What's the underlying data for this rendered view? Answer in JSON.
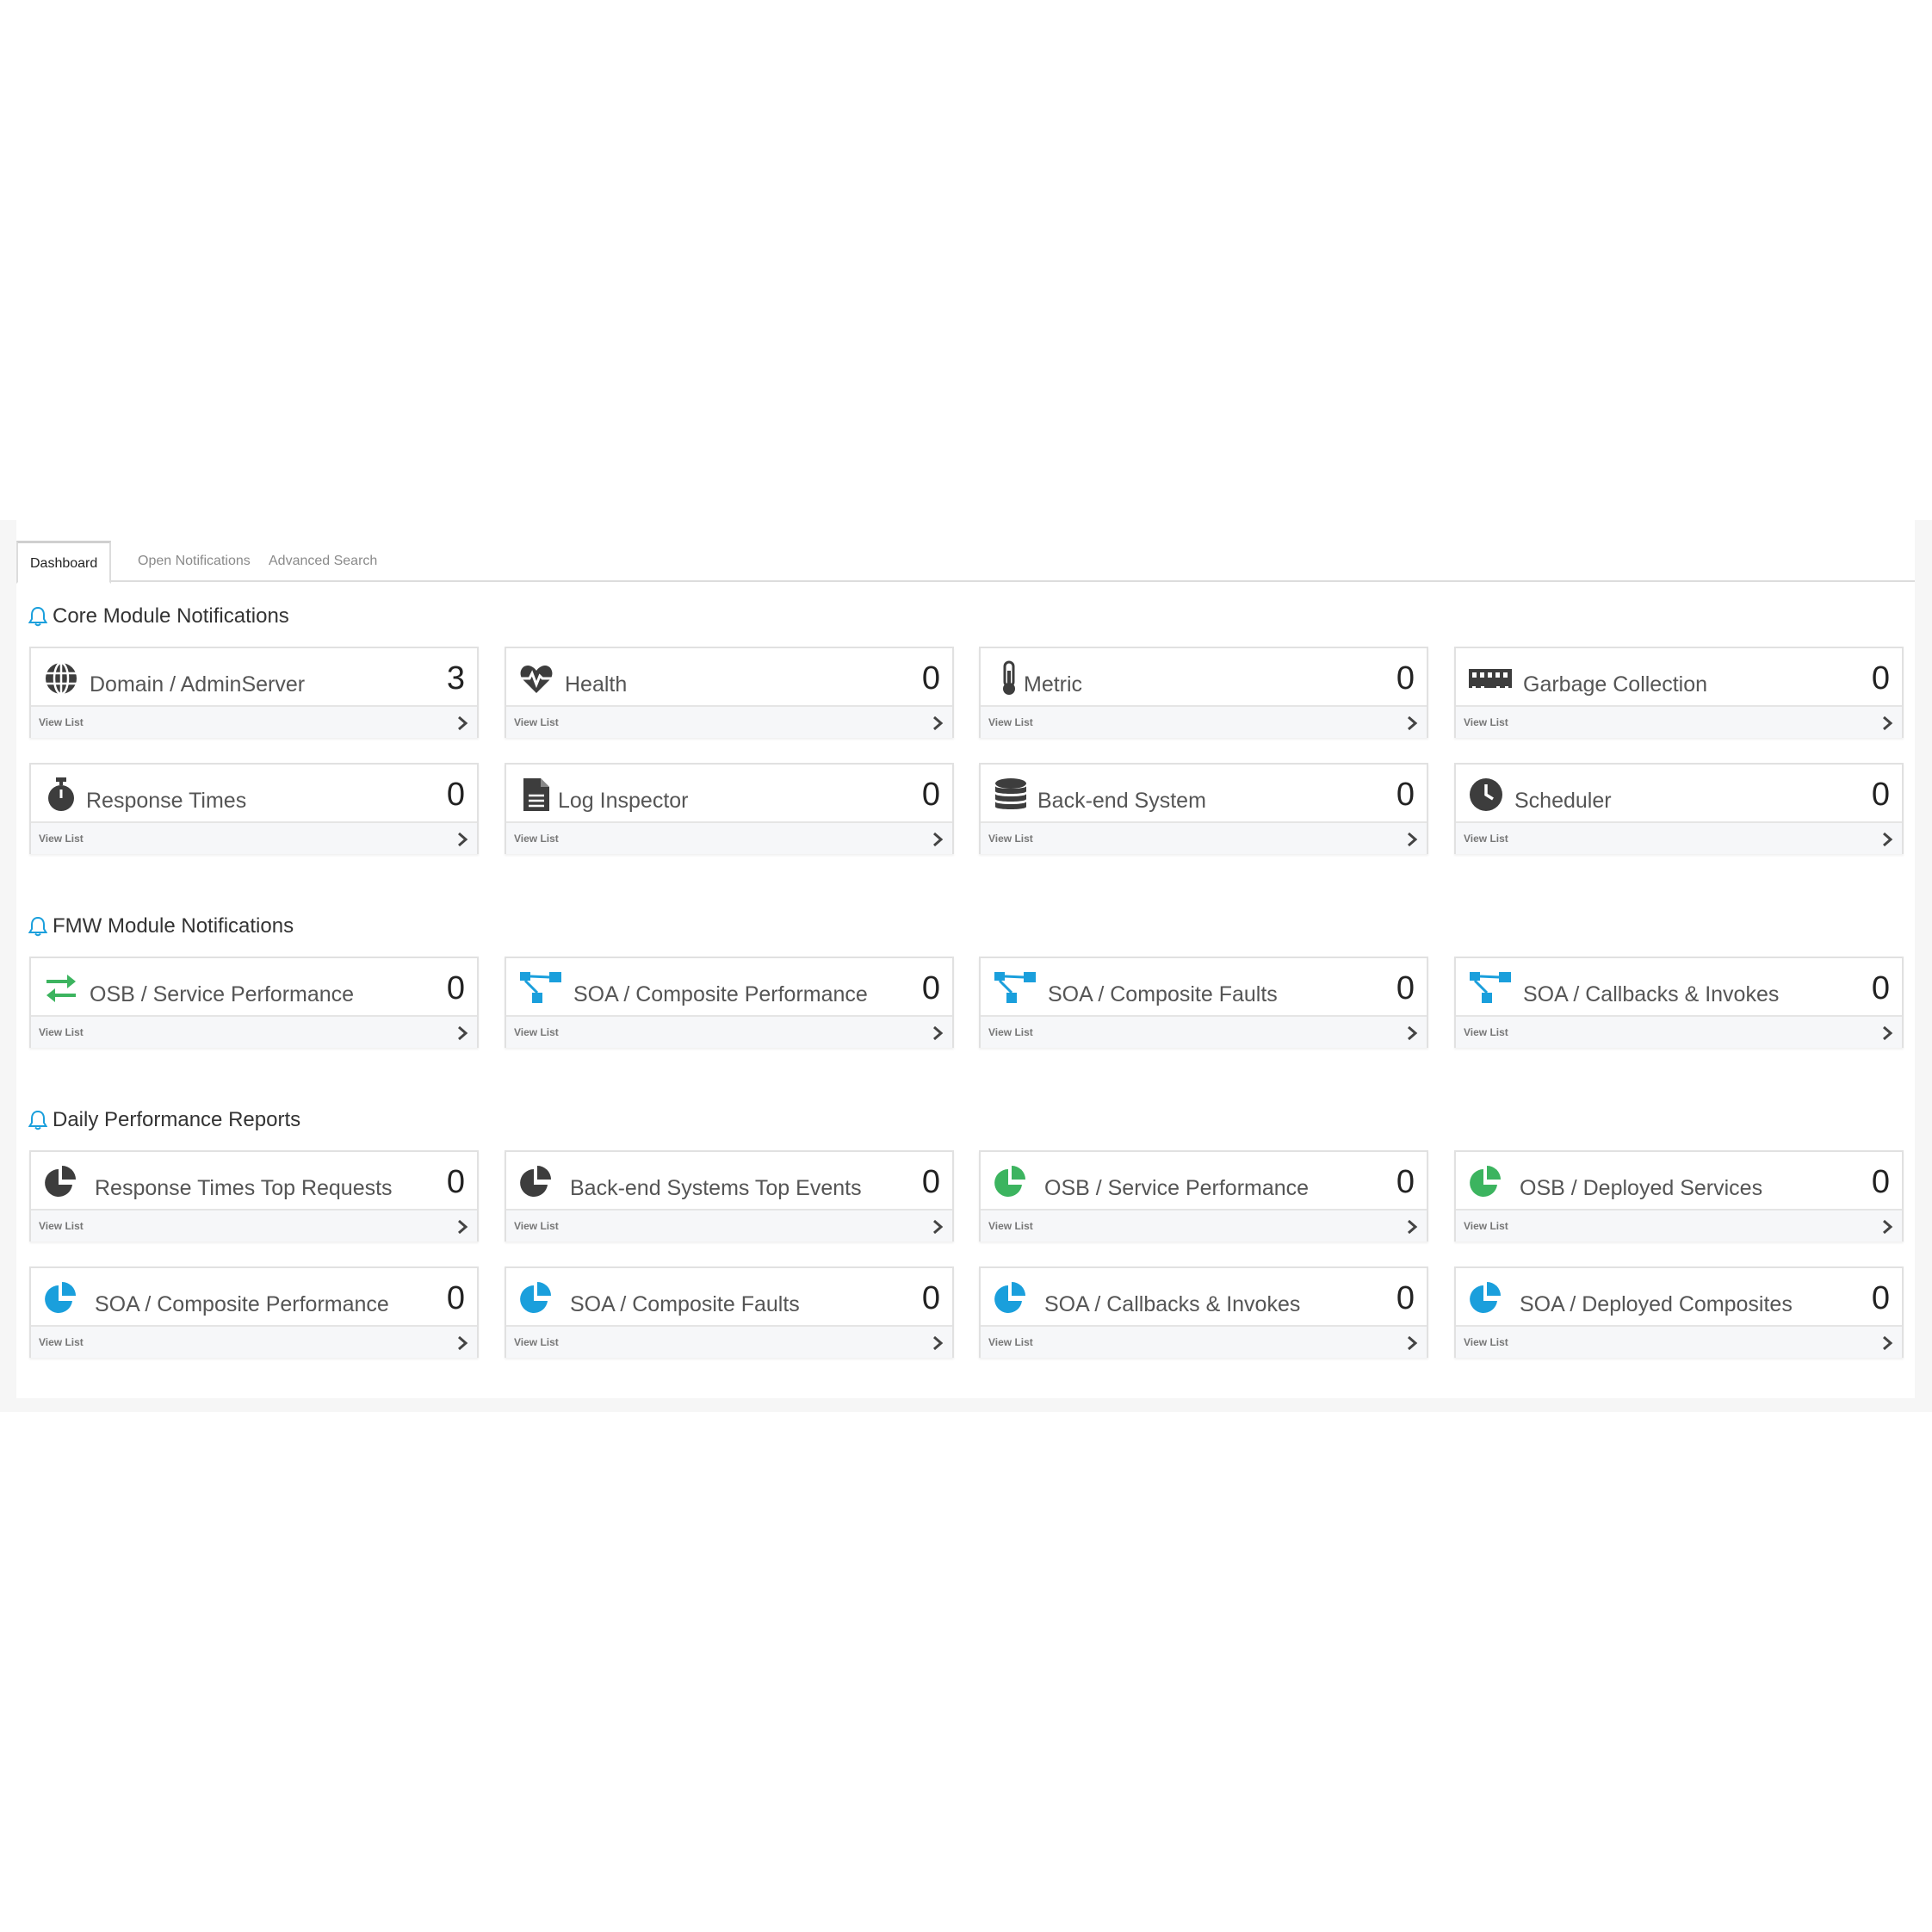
{
  "tabs": {
    "dashboard": "Dashboard",
    "open_notifications": "Open Notifications",
    "advanced_search": "Advanced Search"
  },
  "colors": {
    "dark_icon": "#3d3d3d",
    "blue": "#1a9fdc",
    "green": "#3cb45f",
    "bell": "#1a9fdc"
  },
  "sections": {
    "core": {
      "title": "Core Module Notifications",
      "cards": [
        {
          "label": "Domain / AdminServer",
          "count": "3",
          "icon": "globe-icon"
        },
        {
          "label": "Health",
          "count": "0",
          "icon": "heartbeat-icon"
        },
        {
          "label": "Metric",
          "count": "0",
          "icon": "thermometer-icon"
        },
        {
          "label": "Garbage Collection",
          "count": "0",
          "icon": "memory-icon"
        },
        {
          "label": "Response Times",
          "count": "0",
          "icon": "stopwatch-icon"
        },
        {
          "label": "Log Inspector",
          "count": "0",
          "icon": "file-icon"
        },
        {
          "label": "Back-end System",
          "count": "0",
          "icon": "database-icon"
        },
        {
          "label": "Scheduler",
          "count": "0",
          "icon": "clock-icon"
        }
      ]
    },
    "fmw": {
      "title": "FMW Module Notifications",
      "cards": [
        {
          "label": "OSB / Service Performance",
          "count": "0",
          "icon": "exchange-icon"
        },
        {
          "label": "SOA / Composite Performance",
          "count": "0",
          "icon": "sitemap-icon"
        },
        {
          "label": "SOA / Composite Faults",
          "count": "0",
          "icon": "sitemap-icon"
        },
        {
          "label": "SOA / Callbacks & Invokes",
          "count": "0",
          "icon": "sitemap-icon"
        }
      ]
    },
    "daily": {
      "title": "Daily Performance Reports",
      "cards": [
        {
          "label": "Response Times Top Requests",
          "count": "0",
          "icon": "pie-chart-icon"
        },
        {
          "label": "Back-end Systems Top Events",
          "count": "0",
          "icon": "pie-chart-icon"
        },
        {
          "label": "OSB / Service Performance",
          "count": "0",
          "icon": "pie-chart-icon"
        },
        {
          "label": "OSB / Deployed Services",
          "count": "0",
          "icon": "pie-chart-icon"
        },
        {
          "label": "SOA / Composite Performance",
          "count": "0",
          "icon": "pie-chart-icon"
        },
        {
          "label": "SOA / Composite Faults",
          "count": "0",
          "icon": "pie-chart-icon"
        },
        {
          "label": "SOA / Callbacks & Invokes",
          "count": "0",
          "icon": "pie-chart-icon"
        },
        {
          "label": "SOA / Deployed Composites",
          "count": "0",
          "icon": "pie-chart-icon"
        }
      ]
    }
  },
  "view_list_label": "View List"
}
